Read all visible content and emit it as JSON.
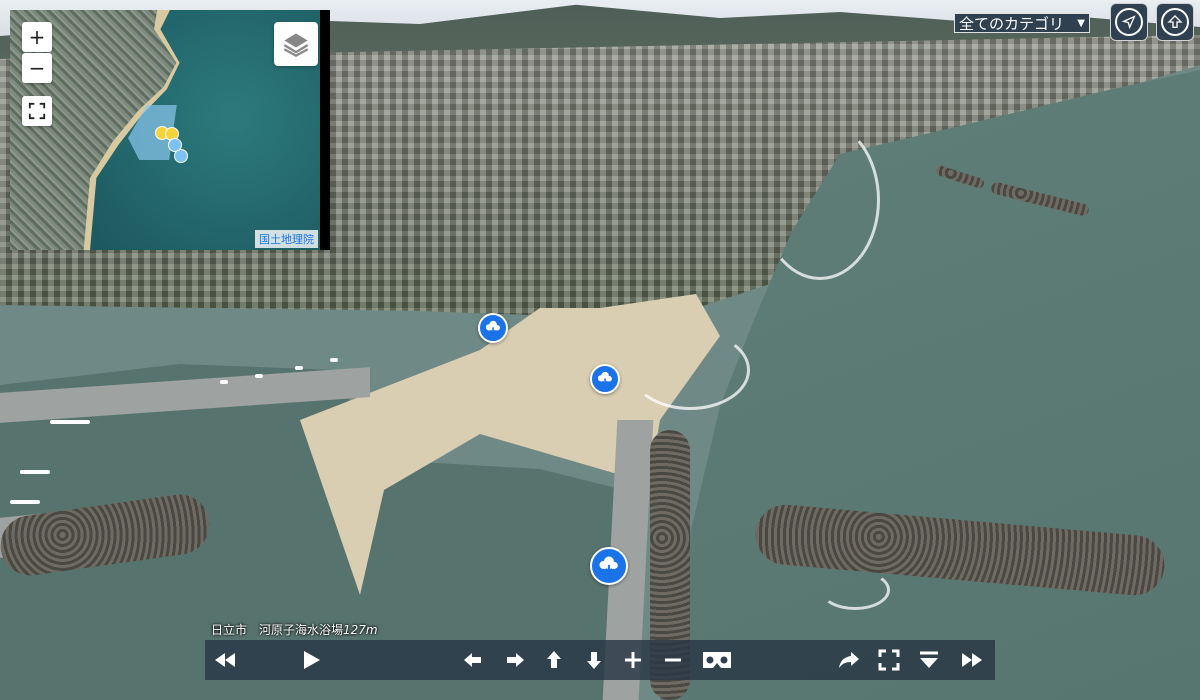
{
  "minimap": {
    "zoom_in_label": "+",
    "zoom_out_label": "−",
    "attribution": "国土地理院"
  },
  "category_select": {
    "selected": "全てのカテゴリ",
    "arrow": "▼"
  },
  "caption": {
    "location": "日立市　河原子海水浴場",
    "distance": "127m"
  },
  "icons": {
    "marker": "cloud-download-icon",
    "locate": "navigation-arrow-icon",
    "home": "up-arrow-circle-icon"
  },
  "colors": {
    "marker": "#1a73e8",
    "toolbar": "#2f4150"
  }
}
